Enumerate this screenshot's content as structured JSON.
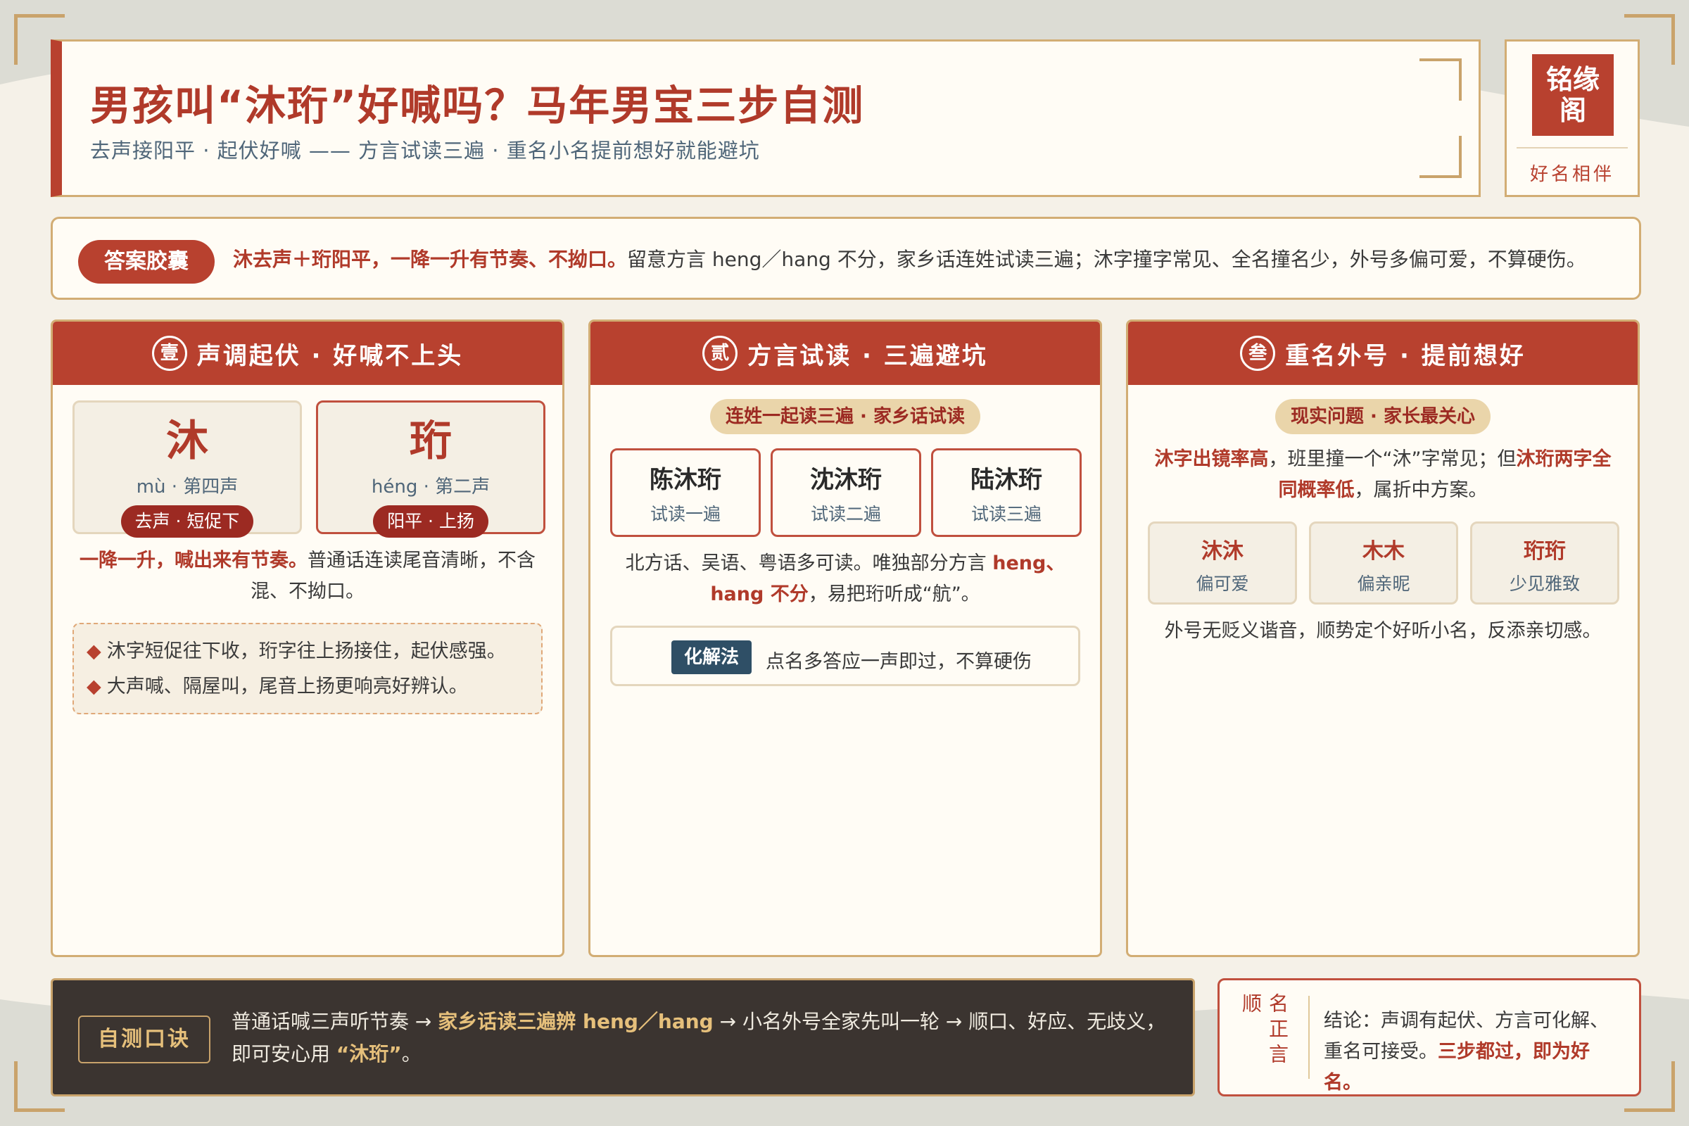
{
  "header": {
    "title": "男孩叫“沐珩”好喊吗？马年男宝三步自测",
    "subtitle": "去声接阳平 · 起伏好喊 —— 方言试读三遍 · 重名小名提前想好就能避坑"
  },
  "brand": {
    "seal_line1": "铭缘",
    "seal_line2": "阁",
    "caption": "好名相伴"
  },
  "answer": {
    "label": "答案胶囊",
    "highlight": "沐去声＋珩阳平，一降一升有节奏、不拗口。",
    "text": "留意方言 heng／hang 不分，家乡话连姓试读三遍；沐字撞字常见、全名撞名少，外号多偏可爱，不算硬伤。"
  },
  "card1": {
    "num": "壹",
    "title": "声调起伏 · 好喊不上头",
    "chars": [
      {
        "char": "沐",
        "pinyin": "mù · 第四声",
        "tag": "去声 · 短促下"
      },
      {
        "char": "珩",
        "pinyin": "héng · 第二声",
        "tag": "阳平 · 上扬"
      }
    ],
    "para_highlight": "一降一升，喊出来有节奏。",
    "para_text": "普通话连读尾音清晰，不含混、不拗口。",
    "notes": [
      "沐字短促往下收，珩字往上扬接住，起伏感强。",
      "大声喊、隔屋叫，尾音上扬更响亮好辨认。"
    ]
  },
  "card2": {
    "num": "贰",
    "title": "方言试读 · 三遍避坑",
    "chip": "连姓一起读三遍 · 家乡话试读",
    "names": [
      {
        "name": "陈沐珩",
        "sub": "试读一遍"
      },
      {
        "name": "沈沐珩",
        "sub": "试读二遍"
      },
      {
        "name": "陆沐珩",
        "sub": "试读三遍"
      }
    ],
    "para_a": "北方话、吴语、粤语多可读。唯独部分方言 ",
    "para_hl": "heng、hang 不分",
    "para_b": "，易把珩听成“航”。",
    "fix_label": "化解法",
    "fix_text": "点名多答应一声即过，不算硬伤"
  },
  "card3": {
    "num": "叁",
    "title": "重名外号 · 提前想好",
    "chip": "现实问题 · 家长最关心",
    "para_hl1": "沐字出镜率高",
    "para_a": "，班里撞一个“沐”字常见；但",
    "para_hl2": "沐珩两字全同概率低",
    "para_b": "，属折中方案。",
    "nicks": [
      {
        "name": "沐沐",
        "sub": "偏可爱"
      },
      {
        "name": "木木",
        "sub": "偏亲昵"
      },
      {
        "name": "珩珩",
        "sub": "少见雅致"
      }
    ],
    "foot": "外号无贬义谐音，顺势定个好听小名，反添亲切感。"
  },
  "mnemonic": {
    "label": "自测口诀",
    "a": "普通话喊三声听节奏 → ",
    "hl": "家乡话读三遍辨 heng／hang",
    "b": " → 小名外号全家先叫一轮 → 顺口、好应、无歧义，即可安心用 ",
    "name": "“沐珩”",
    "c": "。"
  },
  "conclusion": {
    "col1": "名正言",
    "col2": "顺",
    "text": "结论：声调有起伏、方言可化解、重名可接受。",
    "hl": "三步都过，即为好名。"
  }
}
